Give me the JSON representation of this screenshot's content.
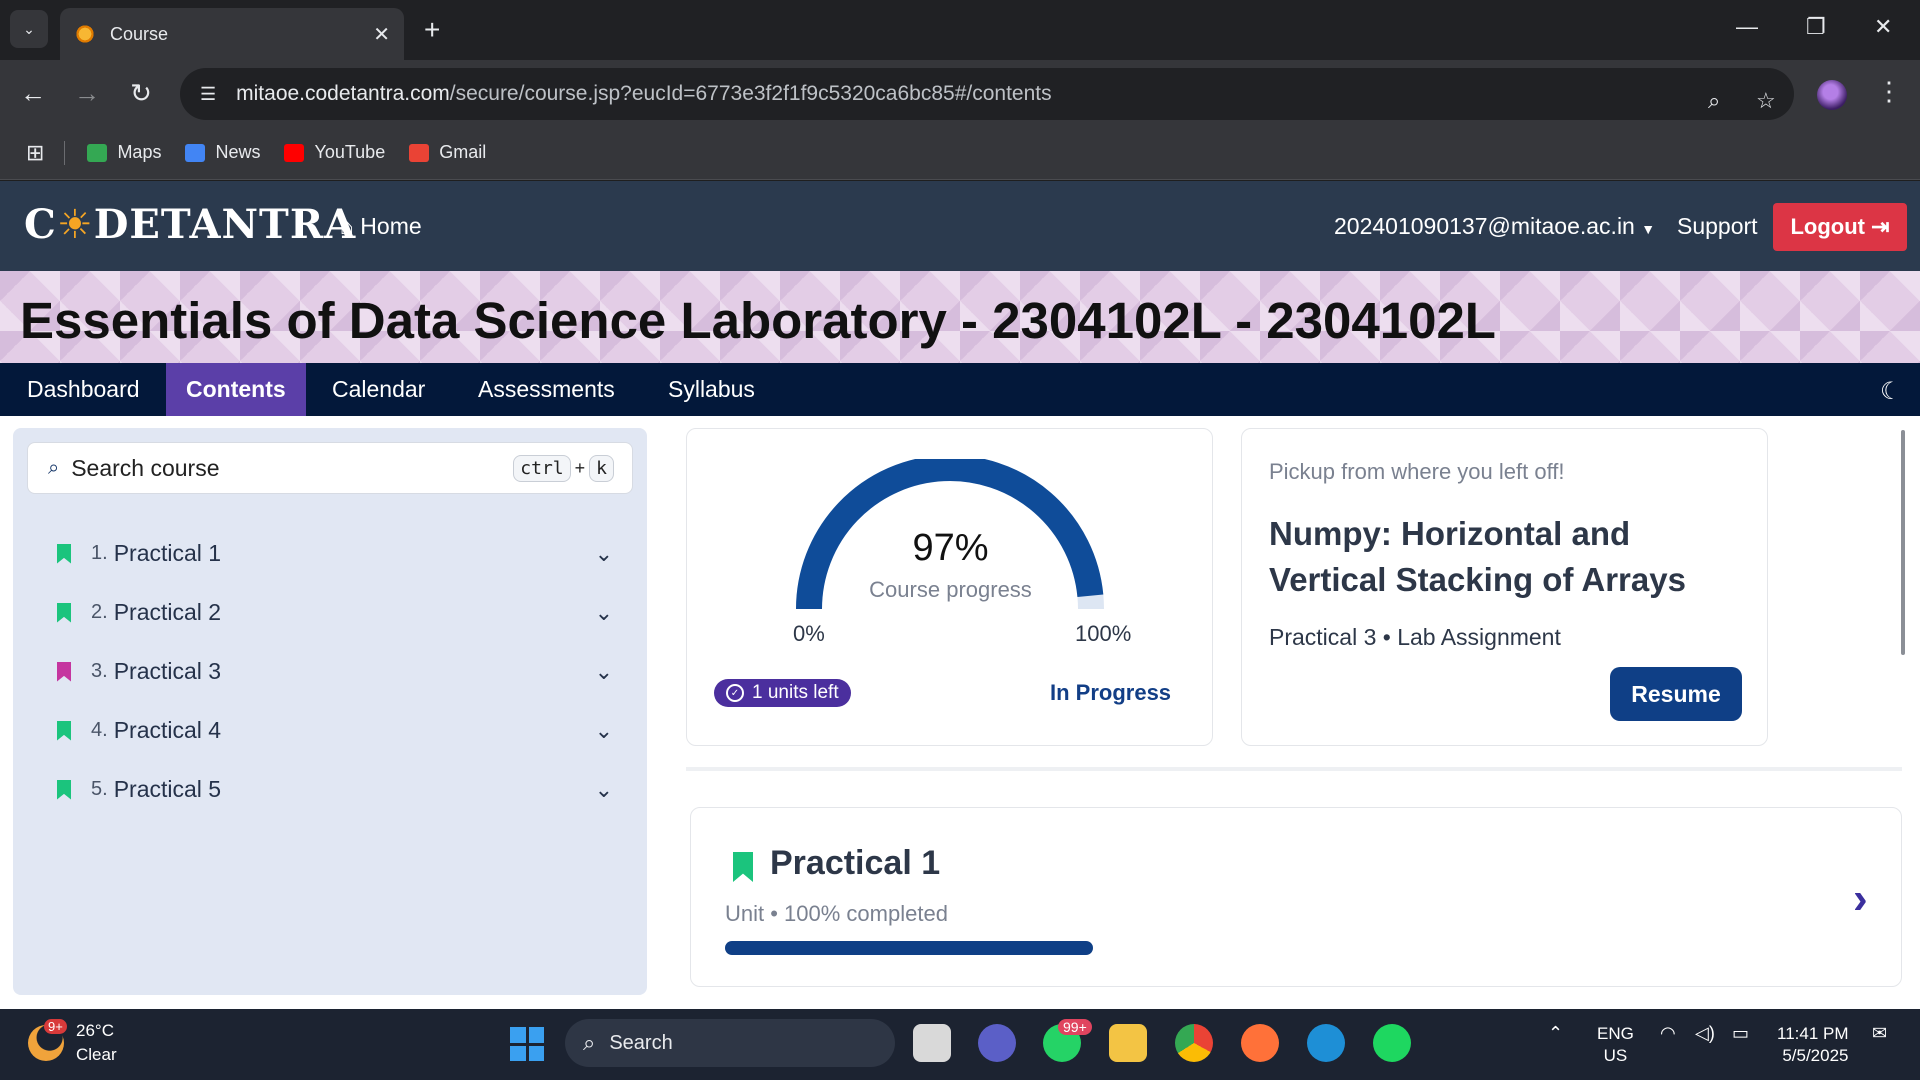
{
  "browser": {
    "tab_title": "Course",
    "url_host": "mitaoe.codetantra.com",
    "url_path": "/secure/course.jsp?eucId=6773e3f2f1f9c5320ca6bc85#/contents",
    "bookmarks": [
      {
        "label": "Maps",
        "color": "#34a853"
      },
      {
        "label": "News",
        "color": "#4285f4"
      },
      {
        "label": "YouTube",
        "color": "#ff0000"
      },
      {
        "label": "Gmail",
        "color": "#ea4335"
      }
    ]
  },
  "app_nav": {
    "logo_pre": "C",
    "logo_post": "DETANTRA",
    "home": "Home",
    "user": "202401090137@mitaoe.ac.in",
    "support": "Support",
    "logout": "Logout"
  },
  "course": {
    "title": "Essentials of Data Science Laboratory - 2304102L - 2304102L",
    "tabs": [
      "Dashboard",
      "Contents",
      "Calendar",
      "Assessments",
      "Syllabus"
    ],
    "active_tab": "Contents"
  },
  "sidebar": {
    "search_placeholder": "Search course",
    "kbd_ctrl": "ctrl",
    "kbd_plus": "+",
    "kbd_k": "k",
    "units": [
      {
        "num": "1.",
        "label": "Practical 1",
        "color": "#1bc47d"
      },
      {
        "num": "2.",
        "label": "Practical 2",
        "color": "#1bc47d"
      },
      {
        "num": "3.",
        "label": "Practical 3",
        "color": "#c5359f"
      },
      {
        "num": "4.",
        "label": "Practical 4",
        "color": "#1bc47d"
      },
      {
        "num": "5.",
        "label": "Practical 5",
        "color": "#1bc47d"
      }
    ]
  },
  "progress": {
    "value": 97,
    "percent_text": "97%",
    "label": "Course progress",
    "min_label": "0%",
    "max_label": "100%",
    "units_left": "1 units left",
    "status": "In Progress"
  },
  "resume": {
    "heading": "Pickup from where you left off!",
    "lesson_title": "Numpy: Horizontal and Vertical Stacking of Arrays",
    "meta": "Practical 3 • Lab Assignment",
    "button": "Resume"
  },
  "unit_card": {
    "title": "Practical 1",
    "subtitle": "Unit • 100% completed",
    "progress": 1.0
  },
  "taskbar": {
    "weather_badge": "9+",
    "temperature": "26°C",
    "condition": "Clear",
    "search": "Search",
    "whatsapp_badge": "99+",
    "lang": "ENG",
    "region": "US",
    "time": "11:41 PM",
    "date": "5/5/2025"
  }
}
